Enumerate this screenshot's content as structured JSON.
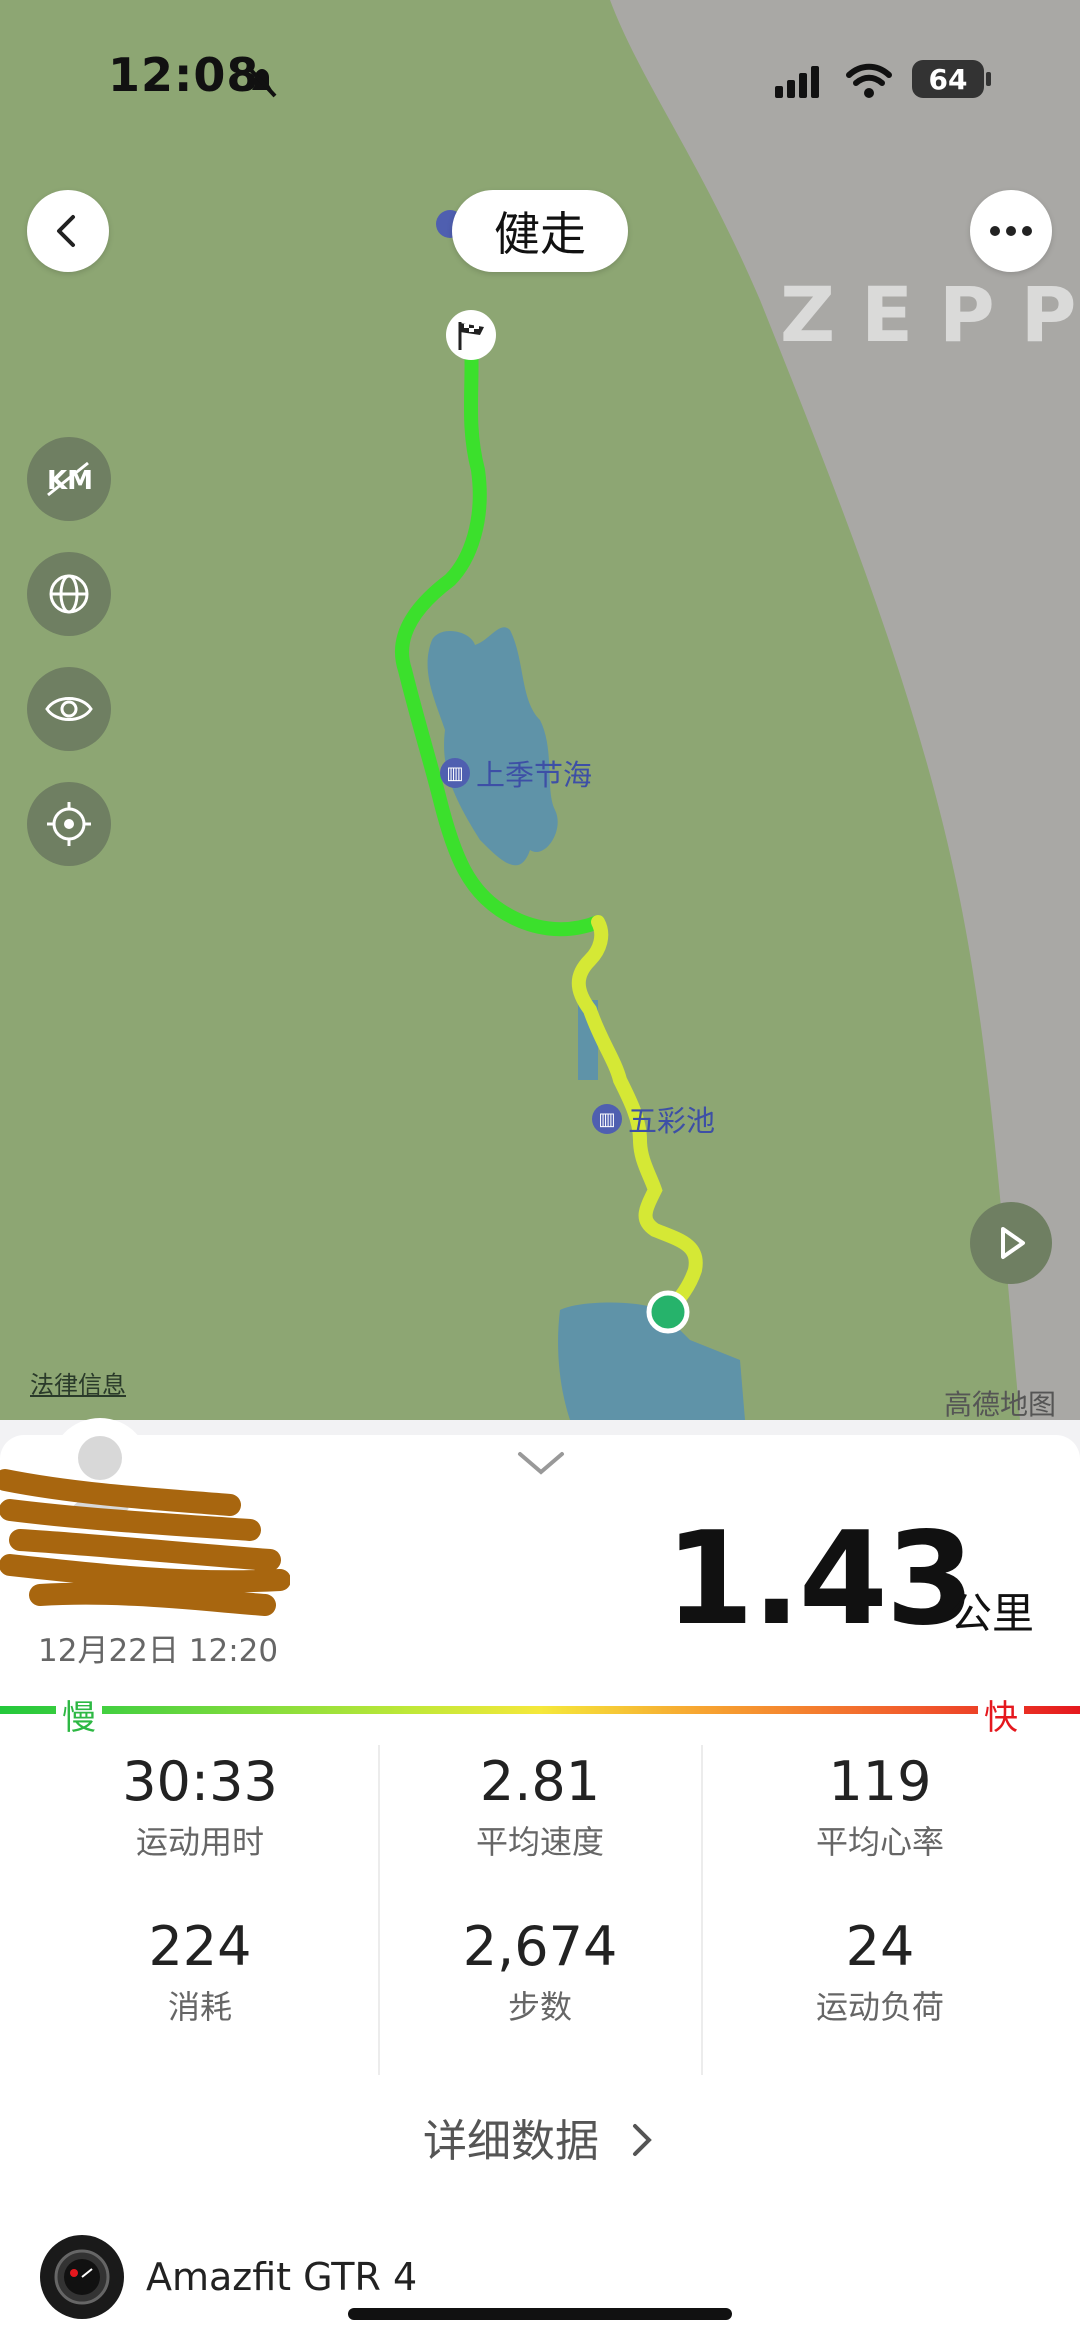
{
  "status_bar": {
    "time": "12:08",
    "battery": "64"
  },
  "header": {
    "activity_type": "健走",
    "watermark": "ZEPP"
  },
  "map": {
    "poi_labels": [
      "上季节海",
      "五彩池"
    ],
    "legal_link": "法律信息",
    "provider": "高德地图",
    "tools": [
      "km-toggle-icon",
      "globe-icon",
      "eye-icon",
      "locate-icon"
    ]
  },
  "summary": {
    "datetime": "12月22日 12:20",
    "distance": "1.43",
    "unit": "公里",
    "speed_legend": {
      "slow": "慢",
      "fast": "快"
    }
  },
  "stats": [
    {
      "value": "30:33",
      "label": "运动用时"
    },
    {
      "value": "2.81",
      "label": "平均速度"
    },
    {
      "value": "119",
      "label": "平均心率"
    },
    {
      "value": "224",
      "label": "消耗"
    },
    {
      "value": "2,674",
      "label": "步数"
    },
    {
      "value": "24",
      "label": "运动负荷"
    }
  ],
  "detail_link": "详细数据",
  "device": {
    "name": "Amazfit GTR 4"
  },
  "colors": {
    "map_green": "#8da673",
    "slow": "#2db843",
    "fast": "#e5181e"
  }
}
